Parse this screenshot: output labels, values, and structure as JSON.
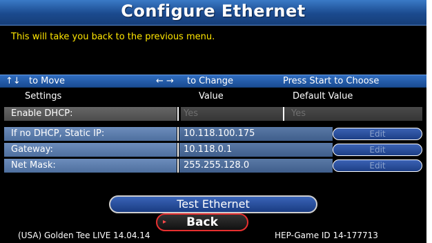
{
  "title": "Configure Ethernet",
  "message": "This will take you back to the previous menu.",
  "help": {
    "move_icon": "↑↓",
    "move_text": "to Move",
    "change_icon": "← →",
    "change_text": "to Change",
    "choose_text": "Press Start to Choose"
  },
  "headers": {
    "settings": "Settings",
    "value": "Value",
    "default": "Default Value"
  },
  "rows": [
    {
      "label": "Enable DHCP:",
      "value": "Yes",
      "default": "Yes"
    },
    {
      "label": "If no DHCP, Static IP:",
      "value": "10.118.100.175",
      "button": "Edit"
    },
    {
      "label": "Gateway:",
      "value": "10.118.0.1",
      "button": "Edit"
    },
    {
      "label": "Net Mask:",
      "value": "255.255.128.0",
      "button": "Edit"
    }
  ],
  "buttons": {
    "test": "Test Ethernet",
    "back": "Back"
  },
  "footer": {
    "version": "(USA) Golden Tee LIVE 14.04.14",
    "game_id": "HEP-Game ID 14-177713"
  },
  "colors": {
    "title_bar": "#1b4a8e",
    "message": "#ffe600",
    "back_border": "#e83030"
  }
}
